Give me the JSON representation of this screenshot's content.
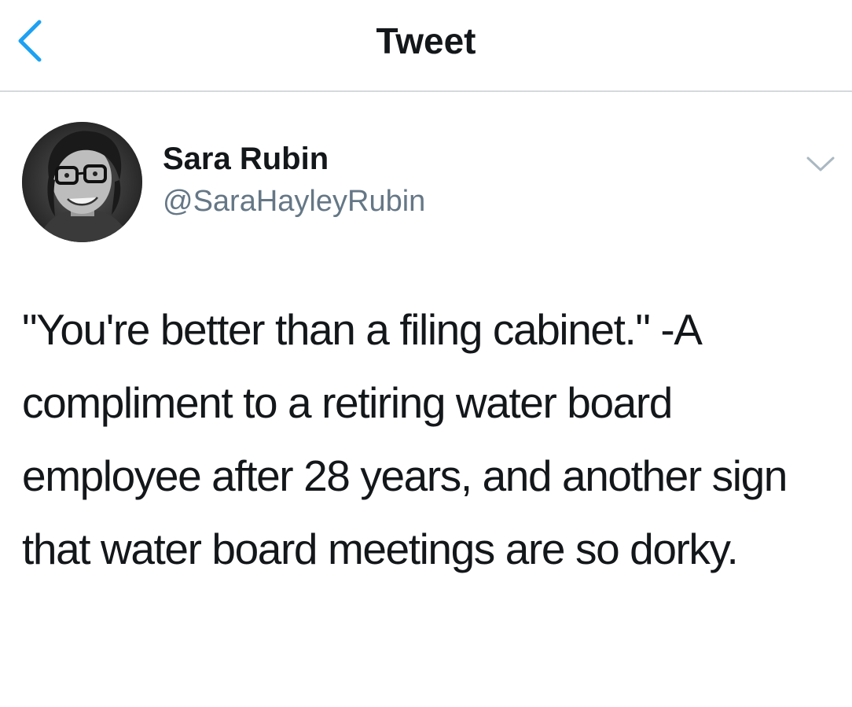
{
  "navbar": {
    "title": "Tweet",
    "back_icon": "chevron-left-icon"
  },
  "author": {
    "display_name": "Sara Rubin",
    "handle": "@SaraHayleyRubin"
  },
  "tweet": {
    "text": "\"You're better than a filing cabinet.\" -A compliment to a retiring water board employee after 28 years, and another sign that water board meetings are so dorky."
  },
  "menu": {
    "icon": "chevron-down-icon"
  },
  "colors": {
    "accent": "#1da1f2",
    "text_primary": "#14171a",
    "text_secondary": "#657786",
    "divider": "#d6d9dc",
    "chevron": "#aab8c2"
  }
}
